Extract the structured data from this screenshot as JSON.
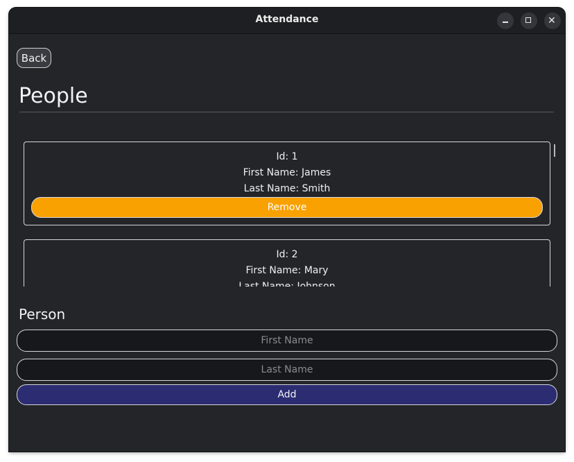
{
  "window": {
    "title": "Attendance"
  },
  "nav": {
    "back_label": "Back"
  },
  "page": {
    "title": "People"
  },
  "people": [
    {
      "id_line": "Id:  1",
      "first_line": "First Name: James",
      "last_line": "Last Name: Smith",
      "remove_label": "Remove"
    },
    {
      "id_line": "Id:  2",
      "first_line": "First Name: Mary",
      "last_line": "Last Name: Johnson"
    }
  ],
  "form": {
    "section_title": "Person",
    "first_name_placeholder": "First Name",
    "last_name_placeholder": "Last Name",
    "first_name_value": "",
    "last_name_value": "",
    "add_label": "Add"
  },
  "colors": {
    "remove_button": "#f9a100",
    "add_button": "#2c2c73",
    "background": "#242529"
  }
}
